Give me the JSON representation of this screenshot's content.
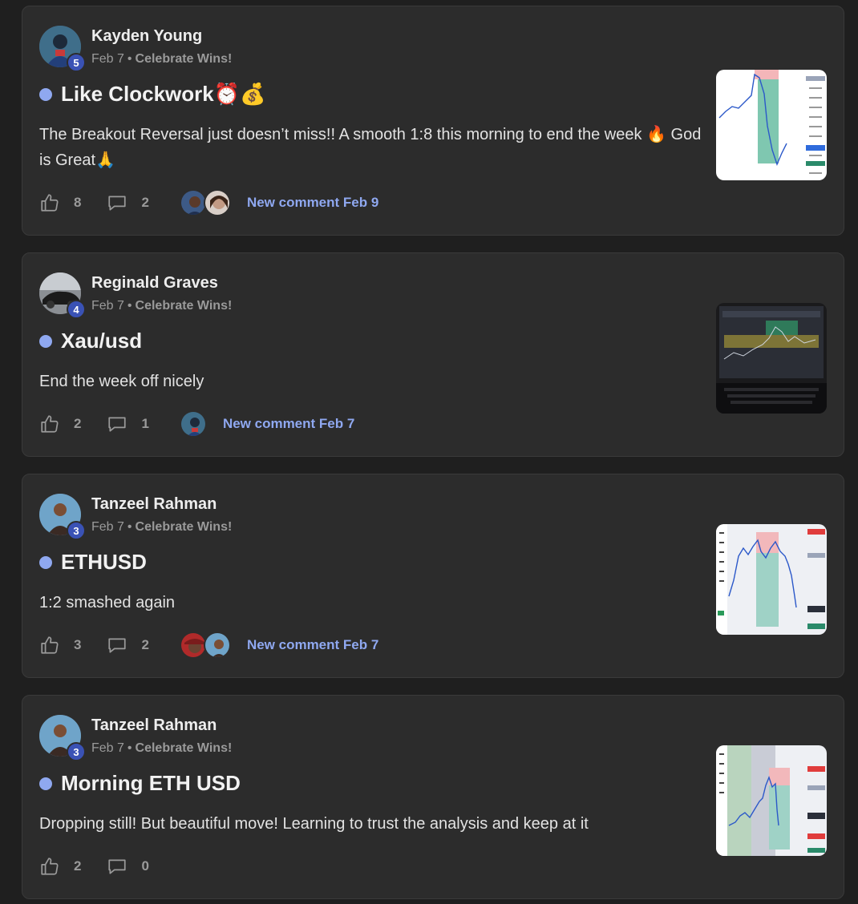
{
  "posts": [
    {
      "author": "Kayden Young",
      "level": "5",
      "date": "Feb 7",
      "separator": "•",
      "category": "Celebrate Wins!",
      "title": "Like Clockwork⏰💰",
      "body": "The Breakout Reversal just doesn’t miss!! A smooth 1:8 this morning to end the week 🔥 God is Great🙏",
      "likes": "8",
      "comments": "2",
      "new_comment": "New comment Feb 9",
      "thumbnail_icon": "chart-screenshot"
    },
    {
      "author": "Reginald Graves",
      "level": "4",
      "date": "Feb 7",
      "separator": "•",
      "category": "Celebrate Wins!",
      "title": "Xau/usd",
      "body": "End the week off nicely",
      "likes": "2",
      "comments": "1",
      "new_comment": "New comment Feb 7",
      "thumbnail_icon": "laptop-chart-photo"
    },
    {
      "author": "Tanzeel Rahman",
      "level": "3",
      "date": "Feb 7",
      "separator": "•",
      "category": "Celebrate Wins!",
      "title": "ETHUSD",
      "body": "1:2 smashed again",
      "likes": "3",
      "comments": "2",
      "new_comment": "New comment Feb 7",
      "thumbnail_icon": "chart-screenshot"
    },
    {
      "author": "Tanzeel Rahman",
      "level": "3",
      "date": "Feb 7",
      "separator": "•",
      "category": "Celebrate Wins!",
      "title": "Morning ETH USD",
      "body": "Dropping still! But beautiful move! Learning to trust the analysis and keep at it",
      "likes": "2",
      "comments": "0",
      "thumbnail_icon": "chart-screenshot"
    }
  ],
  "colors": {
    "background": "#1f1f1f",
    "card": "#2c2c2c",
    "accent_link": "#8fa8f0",
    "level_badge": "#3a52b5"
  },
  "icons": [
    "thumbs-up-icon",
    "comment-bubble-icon"
  ]
}
